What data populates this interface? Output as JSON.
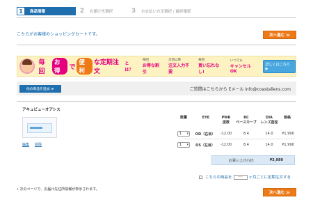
{
  "steps": [
    {
      "num": "1",
      "label": "商品情報"
    },
    {
      "num": "2",
      "label": "お届け先選択"
    },
    {
      "num": "3",
      "label": "お支払い方法選択 / 最終確認"
    }
  ],
  "cart_title": "こちらがお客様のショッピングカートです。",
  "next_button": "次へ進む ≫",
  "banner": {
    "main_1": "毎回",
    "pill_1": "お得",
    "main_2": "で",
    "pill_2": "便利",
    "main_3": "な定期注文",
    "main_4": "とは？",
    "info": [
      {
        "small": "毎回",
        "big": "お得な割引"
      },
      {
        "small": "次回以降",
        "big": "注文入力不要"
      },
      {
        "small": "毎回",
        "big": "買い忘れなし!"
      },
      {
        "small": "いつでも",
        "big": "キャンセルOK"
      }
    ],
    "detail_button": "詳しくはこちら ▶"
  },
  "add_button": "他の商品を追加 ≫",
  "contact_text": "ご質問はこちらから Eメール info@coastallens.com",
  "product": {
    "name": "アキュビューオアシス",
    "edit": "編集",
    "delete": "削除",
    "headers": {
      "qty": "数量",
      "eye": "EYE",
      "pwr_1": "PWR",
      "pwr_2": "度数",
      "bc_1": "BC",
      "bc_2": "ベースカーブ",
      "dia_1": "DIA",
      "dia_2": "レンズ直径",
      "price": "価格"
    },
    "rows": [
      {
        "qty": "1",
        "eye": "OD（右目）",
        "pwr": "-12.00",
        "bc": "8.4",
        "dia": "14.0",
        "price": "¥1,990"
      },
      {
        "qty": "1",
        "eye": "OS（左目）",
        "pwr": "-12.00",
        "bc": "8.4",
        "dia": "14.0",
        "price": "¥1,990"
      }
    ]
  },
  "subtotal": {
    "label": "お買い上げ小計:",
    "value": "¥3,980"
  },
  "regular_order": {
    "pre": "こちらの商品を",
    "select": "----",
    "post": "ヶ月ごとに定期注文する"
  },
  "note": "• 次のページで、お届け先住所情報が表示されます。",
  "colors": {
    "accent": "#1f6fae",
    "orange": "#ee7a17",
    "pink": "#e4007f"
  }
}
